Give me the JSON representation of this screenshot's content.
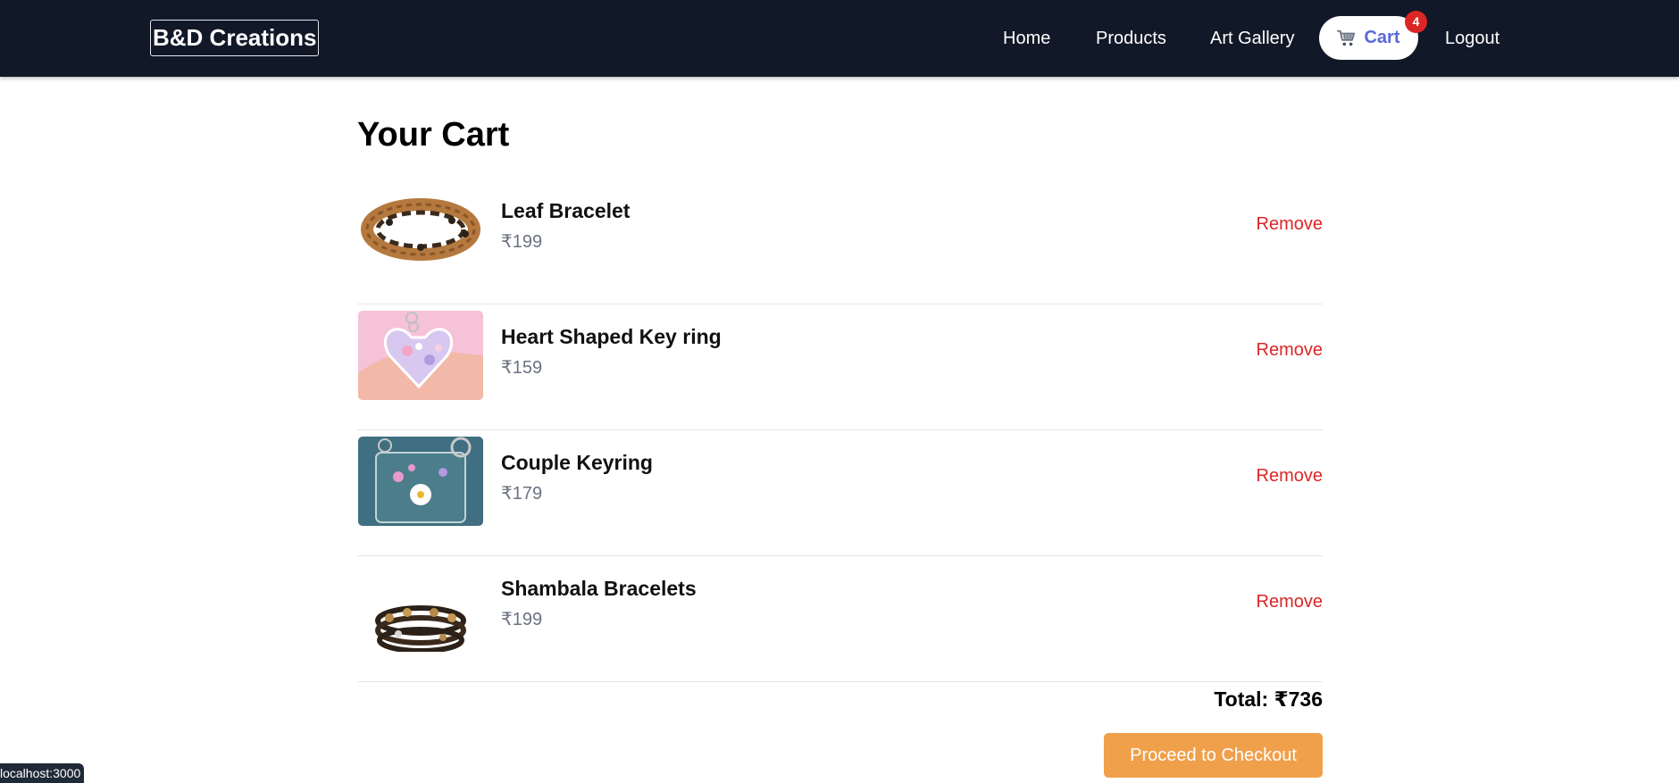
{
  "brand": {
    "name": "B&D Creations"
  },
  "nav": {
    "home": "Home",
    "products": "Products",
    "gallery": "Art Gallery",
    "cart": "Cart",
    "cart_count": "4",
    "logout": "Logout",
    "cart_icon": "cart-icon"
  },
  "page": {
    "title": "Your Cart"
  },
  "cart": {
    "items": [
      {
        "name": "Leaf Bracelet",
        "price": "₹199",
        "remove_label": "Remove",
        "image": "leaf-bracelet-image"
      },
      {
        "name": "Heart Shaped Key ring",
        "price": "₹159",
        "remove_label": "Remove",
        "image": "heart-keyring-image"
      },
      {
        "name": "Couple Keyring",
        "price": "₹179",
        "remove_label": "Remove",
        "image": "couple-keyring-image"
      },
      {
        "name": "Shambala Bracelets",
        "price": "₹199",
        "remove_label": "Remove",
        "image": "shambala-bracelets-image"
      }
    ],
    "total_label": "Total: ₹736",
    "checkout_label": "Proceed to Checkout"
  },
  "status_bar": {
    "url": "localhost:3000"
  },
  "colors": {
    "nav_bg": "#111827",
    "cart_accent": "#5a67d8",
    "badge": "#dc2626",
    "remove": "#dc2626",
    "checkout": "#f0a04b",
    "price": "#6b7280"
  }
}
